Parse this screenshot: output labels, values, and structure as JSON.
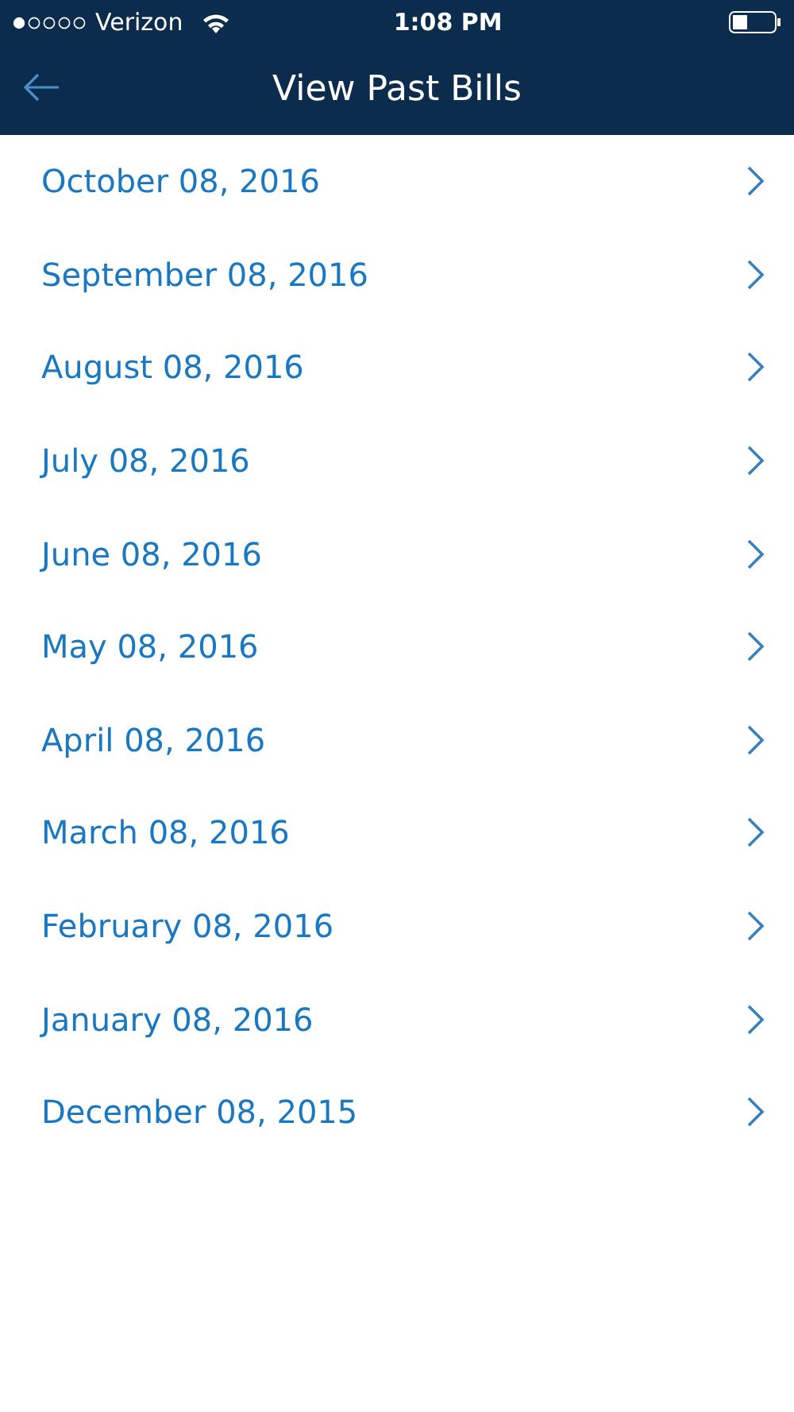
{
  "status_bar": {
    "carrier": "Verizon",
    "time": "1:08 PM"
  },
  "nav_bar": {
    "title": "View Past Bills"
  },
  "bills": [
    {
      "date": "October 08, 2016"
    },
    {
      "date": "September 08, 2016"
    },
    {
      "date": "August 08, 2016"
    },
    {
      "date": "July 08, 2016"
    },
    {
      "date": "June 08, 2016"
    },
    {
      "date": "May 08, 2016"
    },
    {
      "date": "April 08, 2016"
    },
    {
      "date": "March 08, 2016"
    },
    {
      "date": "February 08, 2016"
    },
    {
      "date": "January 08, 2016"
    },
    {
      "date": "December 08, 2015"
    }
  ]
}
